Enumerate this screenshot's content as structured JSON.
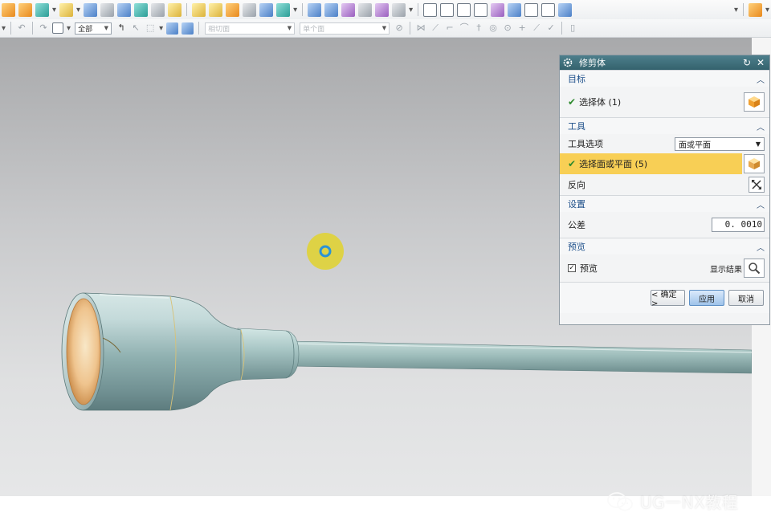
{
  "toolbar2": {
    "filter_value": "全部",
    "snap_dropdown_1": "相切面",
    "snap_dropdown_2": "单个面"
  },
  "dialog": {
    "title": "修剪体",
    "target": {
      "heading": "目标",
      "select_body_label": "选择体 (1)"
    },
    "tool": {
      "heading": "工具",
      "tool_option_label": "工具选项",
      "tool_option_value": "面或平面",
      "select_face_label": "选择面或平面 (5)",
      "reverse_label": "反向"
    },
    "settings": {
      "heading": "设置",
      "tolerance_label": "公差",
      "tolerance_value": "0. 0010"
    },
    "preview": {
      "heading": "预览",
      "preview_checkbox_label": "预览",
      "show_result_label": "显示结果"
    },
    "buttons": {
      "ok": "< 确定 >",
      "apply": "应用",
      "cancel": "取消"
    }
  },
  "watermark": {
    "text": "UG一NX教程"
  },
  "colors": {
    "model_teal": "#a9c3c2",
    "model_inner": "#e0a66a",
    "highlight": "#f8cf55",
    "cursor_ring": "#e0d33a",
    "title_bar": "#3f6f7b"
  }
}
